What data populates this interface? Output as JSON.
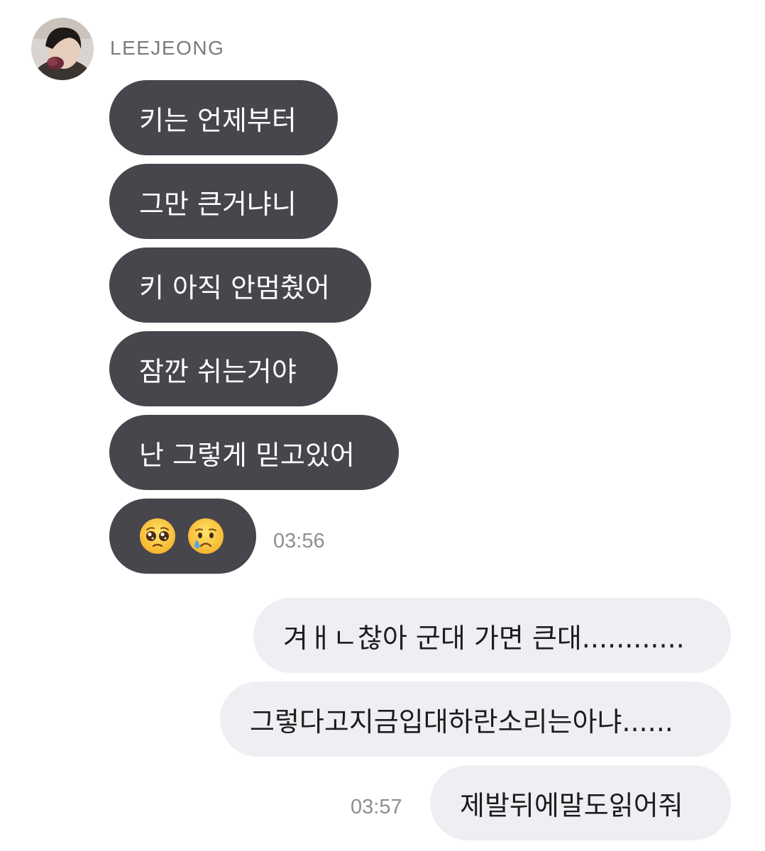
{
  "sender": {
    "name": "LEEJEONG",
    "avatar": "profile-photo"
  },
  "incoming": [
    "키는 언제부터",
    "그만 큰거냐니",
    "키 아직 안멈췄어",
    "잠깐 쉬는거야",
    "난 그렇게 믿고있어"
  ],
  "incoming_emoji": [
    "pleading-face-emoji",
    "crying-face-emoji"
  ],
  "incoming_time": "03:56",
  "outgoing": [
    "겨ㅐㄴ찮아 군대 가면 큰대............",
    "그렇다고지금입대하란소리는아냐......",
    "제발뒤에말도읽어줘"
  ],
  "outgoing_time": "03:57",
  "colors": {
    "incoming_bubble": "#46464c",
    "outgoing_bubble": "#efeff3",
    "timestamp": "#8e8e93",
    "sender_name": "#7b7b7b"
  }
}
